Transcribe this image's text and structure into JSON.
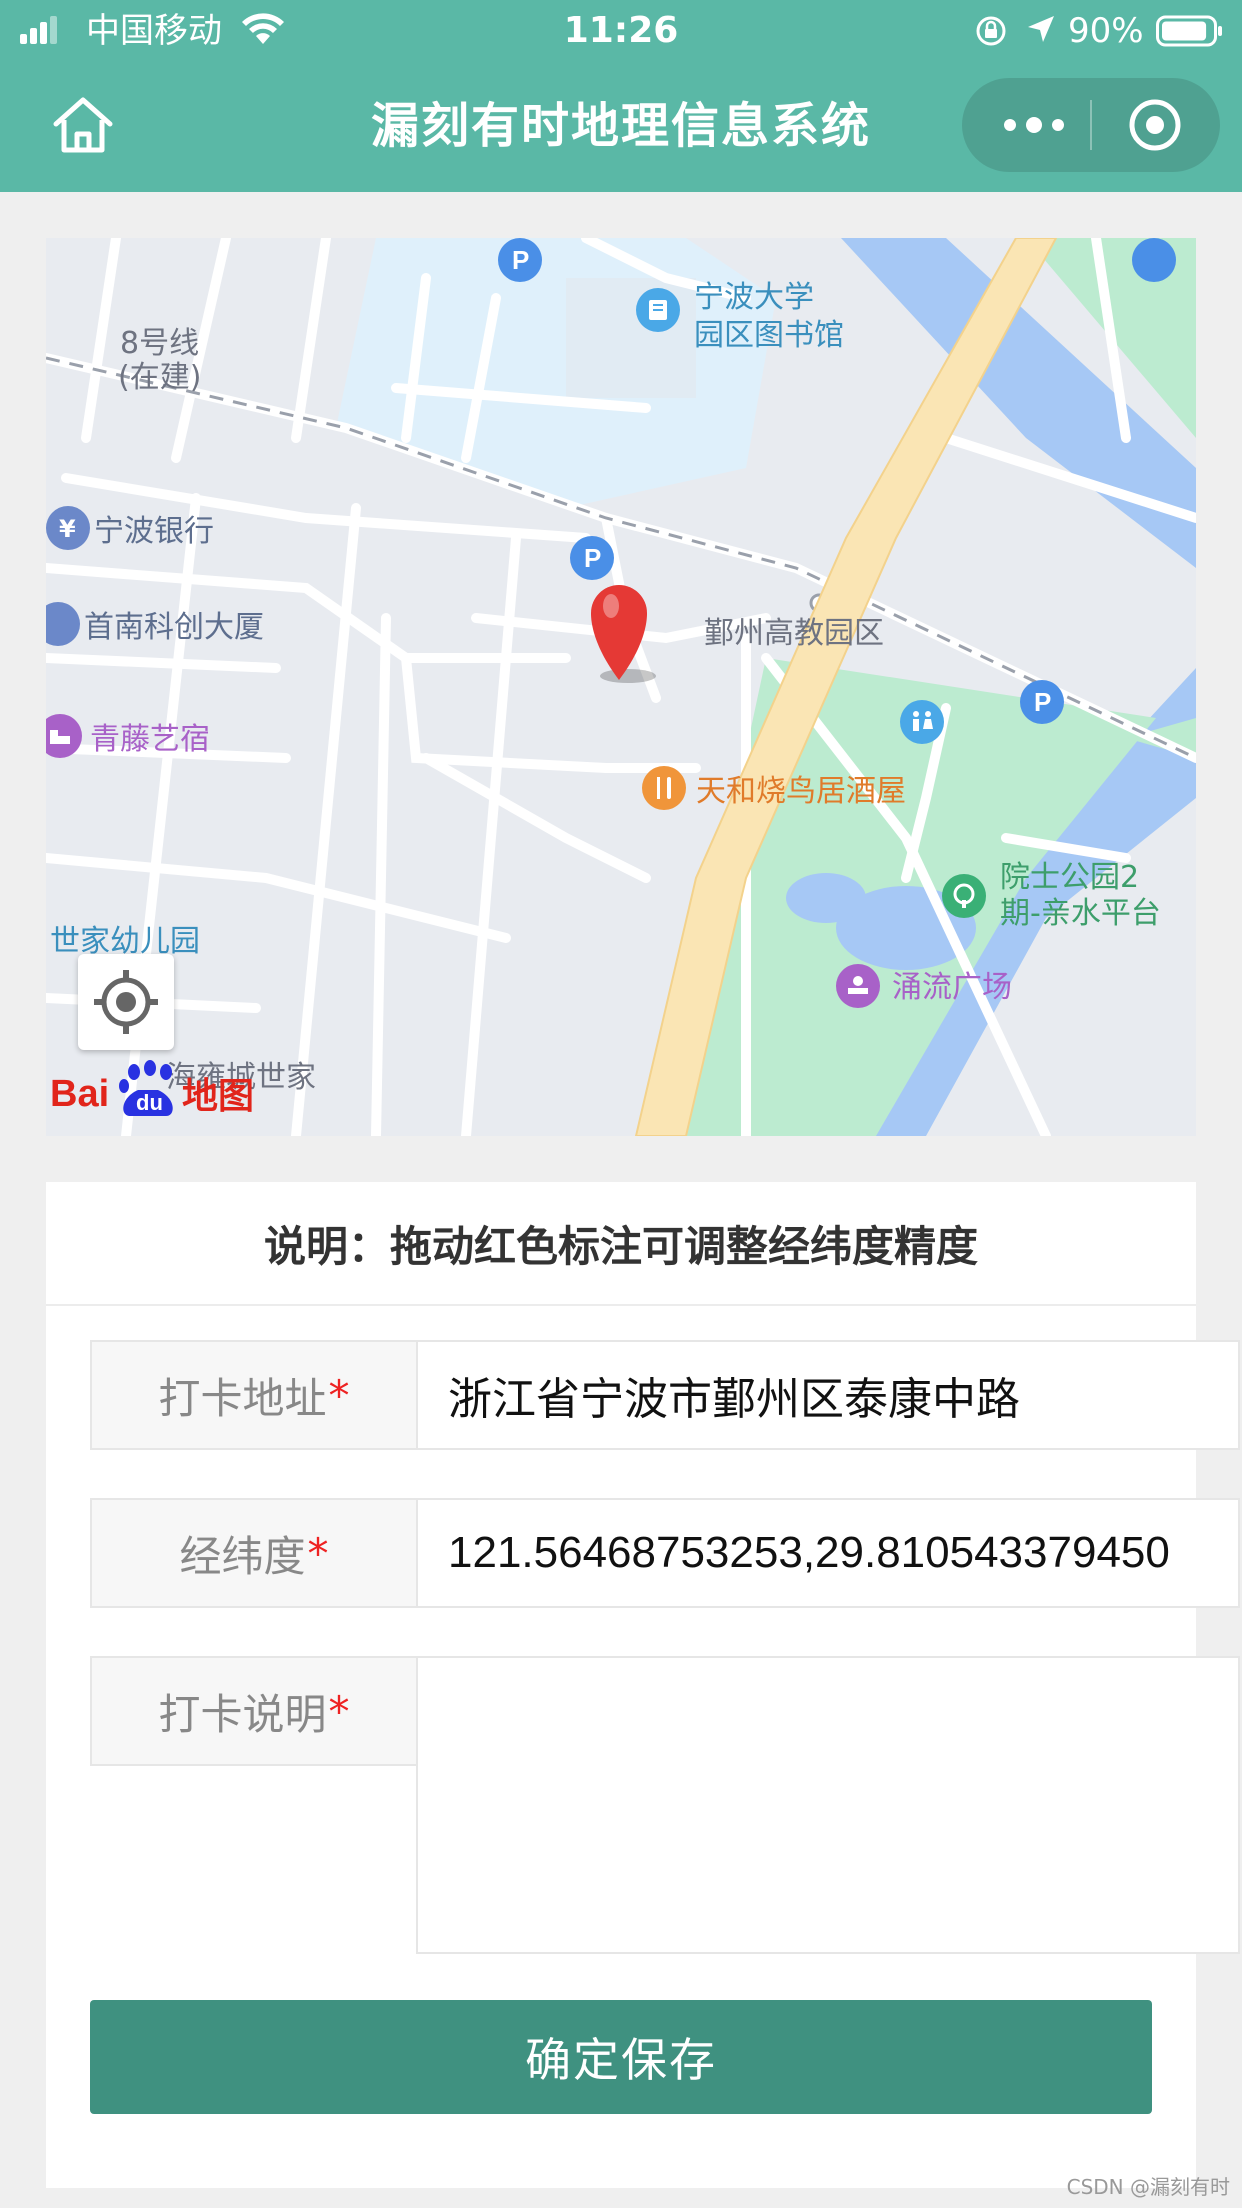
{
  "status_bar": {
    "carrier": "中国移动",
    "time": "11:26",
    "battery": "90%",
    "battery_level": 0.9
  },
  "nav": {
    "title": "漏刻有时地理信息系统"
  },
  "map": {
    "labels": {
      "line8": "8号线",
      "line8_sub": "(在建)",
      "library_1": "宁波大学",
      "library_2": "园区图书馆",
      "bank": "宁波银行",
      "building": "首南科创大厦",
      "hotel": "青藤艺宿",
      "campus": "鄞州高教园区",
      "restaurant": "天和烧鸟居酒屋",
      "park_1": "院士公园2",
      "park_2": "期-亲水平台",
      "kindergarten": "世家幼儿园",
      "square": "涌流广场",
      "residence": "海雍城世家",
      "logo_text": "Baidu地图"
    },
    "colors": {
      "water": "#a6c8f5",
      "green": "#bcebd0",
      "road_main": "#fae5b4",
      "pin": "#e53935"
    }
  },
  "form": {
    "notice": "说明：拖动红色标注可调整经纬度精度",
    "address_label": "打卡地址",
    "address_value": "浙江省宁波市鄞州区泰康中路",
    "coords_label": "经纬度",
    "coords_value": "121.56468753253,29.810543379450",
    "note_label": "打卡说明",
    "note_value": "",
    "required_mark": "*",
    "save_label": "确定保存"
  },
  "watermark": "CSDN @漏刻有时",
  "theme": {
    "header_bg": "#5ab8a6",
    "button_bg": "#3f9180"
  }
}
